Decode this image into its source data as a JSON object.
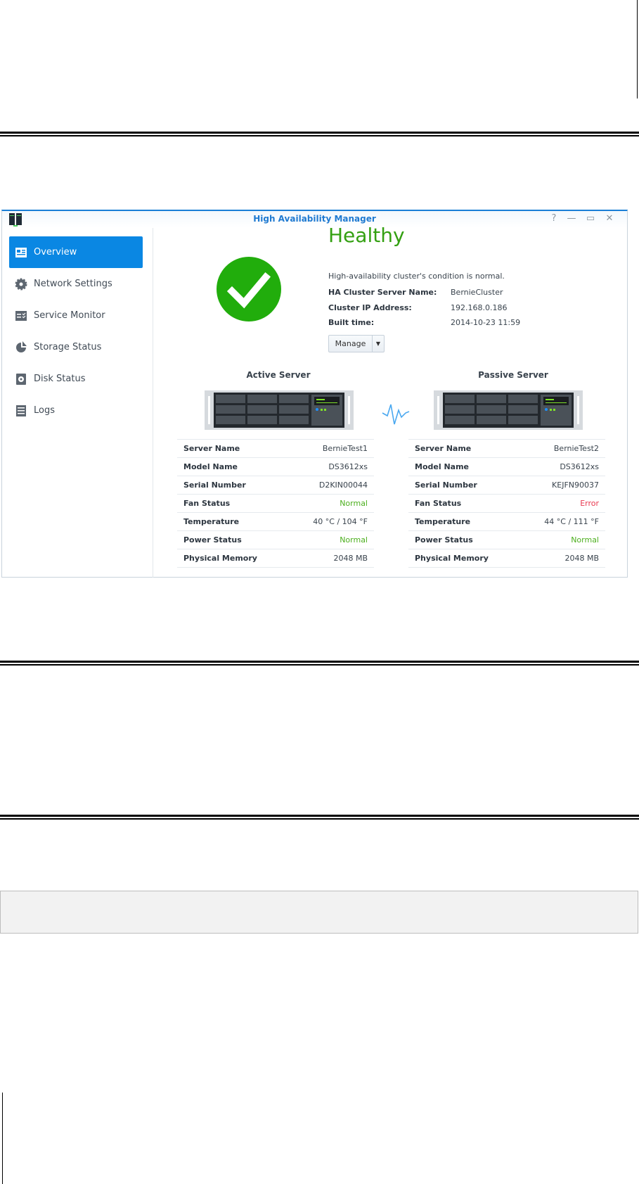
{
  "window": {
    "title": "High Availability Manager",
    "controls": [
      "?",
      "—",
      "▭",
      "✕"
    ]
  },
  "sidebar": {
    "items": [
      {
        "label": "Overview",
        "icon": "overview-icon",
        "active": true
      },
      {
        "label": "Network Settings",
        "icon": "gear-icon"
      },
      {
        "label": "Service Monitor",
        "icon": "service-monitor-icon"
      },
      {
        "label": "Storage Status",
        "icon": "pie-chart-icon"
      },
      {
        "label": "Disk Status",
        "icon": "disk-icon"
      },
      {
        "label": "Logs",
        "icon": "logs-icon"
      }
    ]
  },
  "status": {
    "title": "Healthy",
    "message": "High-availability cluster's condition is normal.",
    "fields": [
      {
        "label": "HA Cluster Server Name:",
        "value": "BernieCluster"
      },
      {
        "label": "Cluster IP Address:",
        "value": "192.168.0.186"
      },
      {
        "label": "Built time:",
        "value": "2014-10-23 11:59"
      }
    ],
    "manage_label": "Manage",
    "color": "#34a012"
  },
  "servers": [
    {
      "title": "Active Server",
      "rows": [
        {
          "label": "Server Name",
          "value": "BernieTest1"
        },
        {
          "label": "Model Name",
          "value": "DS3612xs"
        },
        {
          "label": "Serial Number",
          "value": "D2KIN00044"
        },
        {
          "label": "Fan Status",
          "value": "Normal",
          "color": "#4caf1e"
        },
        {
          "label": "Temperature",
          "value": "40 °C / 104 °F"
        },
        {
          "label": "Power Status",
          "value": "Normal",
          "color": "#4caf1e"
        },
        {
          "label": "Physical Memory",
          "value": "2048 MB"
        }
      ]
    },
    {
      "title": "Passive Server",
      "rows": [
        {
          "label": "Server Name",
          "value": "BernieTest2"
        },
        {
          "label": "Model Name",
          "value": "DS3612xs"
        },
        {
          "label": "Serial Number",
          "value": "KEJFN90037"
        },
        {
          "label": "Fan Status",
          "value": "Error",
          "color": "#e8384f"
        },
        {
          "label": "Temperature",
          "value": "44 °C / 111 °F"
        },
        {
          "label": "Power Status",
          "value": "Normal",
          "color": "#4caf1e"
        },
        {
          "label": "Physical Memory",
          "value": "2048 MB"
        }
      ]
    }
  ]
}
